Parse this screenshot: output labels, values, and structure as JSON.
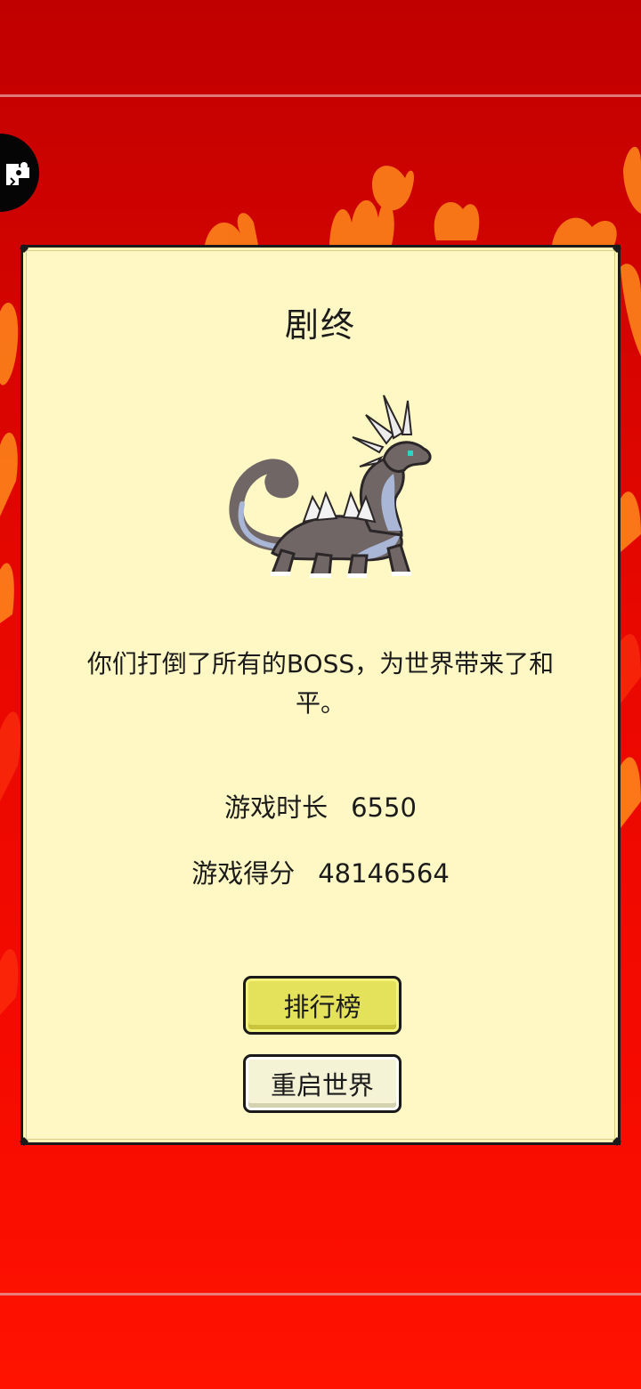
{
  "colors": {
    "background": "#e80800",
    "panel": "#fff8c4",
    "rank_button": "#e4e25a",
    "restart_button": "#f4f3d6"
  },
  "side_tab": {
    "icon": "puzzle-icon"
  },
  "dialog": {
    "title": "剧终",
    "image": "dragon-boss-sprite",
    "message": "你们打倒了所有的BOSS，为世界带来了和平。",
    "stats": {
      "time_label": "游戏时长",
      "time_value": "6550",
      "score_label": "游戏得分",
      "score_value": "48146564"
    },
    "buttons": {
      "leaderboard": "排行榜",
      "restart": "重启世界"
    }
  }
}
